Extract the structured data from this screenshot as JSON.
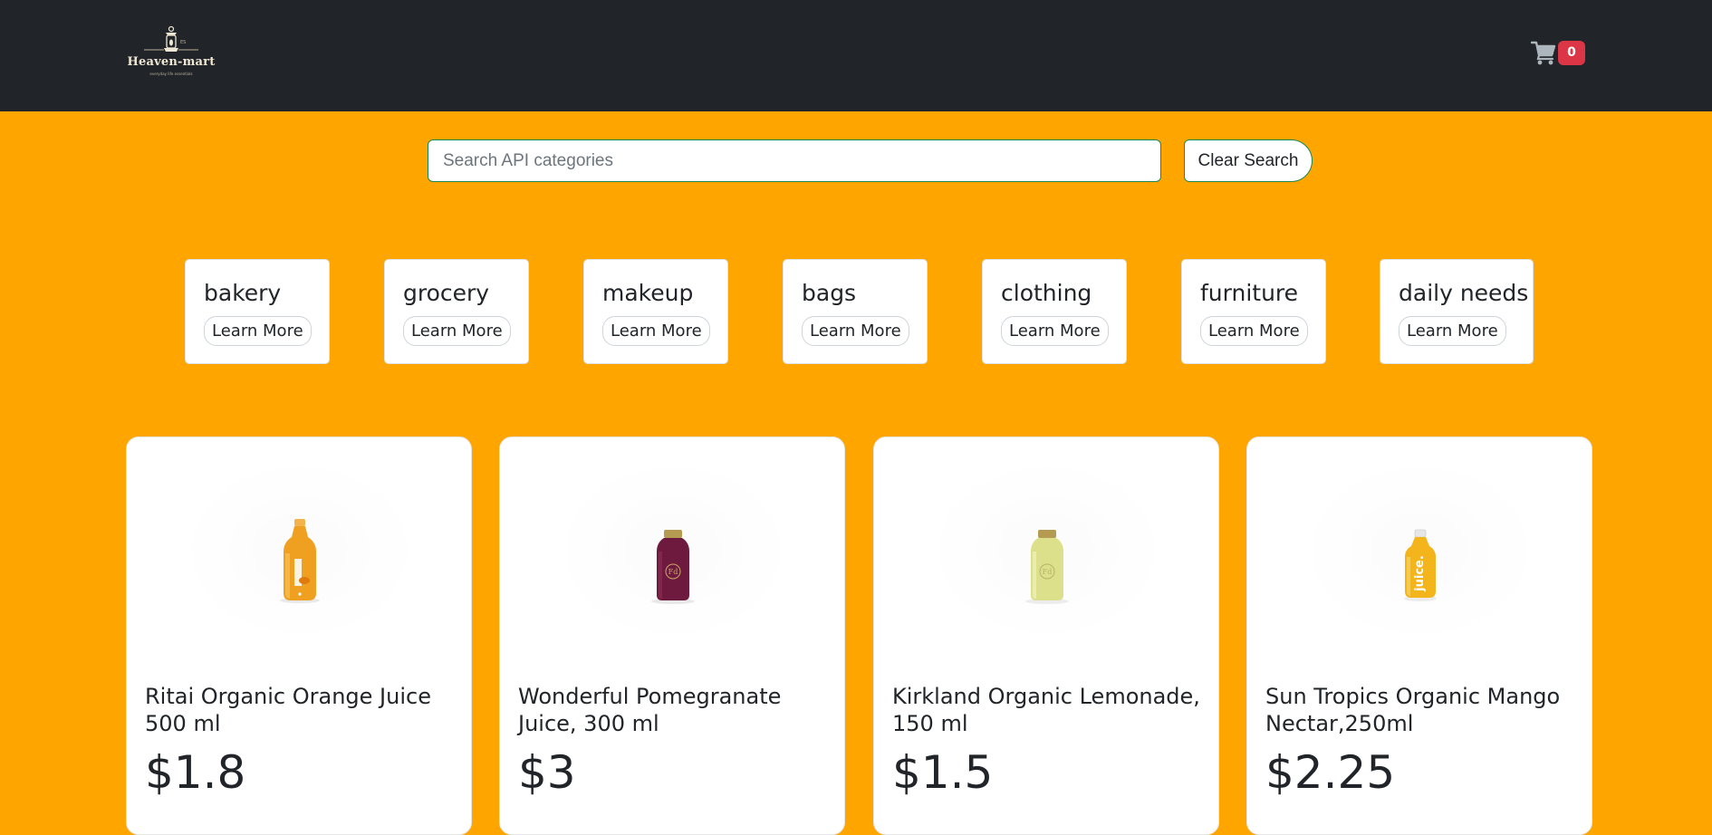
{
  "header": {
    "logo_text": "Heaven-mart",
    "logo_tagline": "everyday life essentials",
    "cart_count": "0",
    "colors": {
      "bar": "#212529",
      "badge": "#dc3545"
    }
  },
  "search": {
    "placeholder": "Search API categories",
    "value": "",
    "clear_label": "Clear Search"
  },
  "categories": [
    {
      "name": "bakery",
      "button": "Learn More"
    },
    {
      "name": "grocery",
      "button": "Learn More"
    },
    {
      "name": "makeup",
      "button": "Learn More"
    },
    {
      "name": "bags",
      "button": "Learn More"
    },
    {
      "name": "clothing",
      "button": "Learn More"
    },
    {
      "name": "furniture",
      "button": "Learn More"
    },
    {
      "name": "daily needs",
      "button": "Learn More"
    }
  ],
  "products": [
    {
      "title": "Ritai Organic Orange Juice 500 ml",
      "price": "$1.8",
      "image": "orange-juice-bottle",
      "color": "#f0a020"
    },
    {
      "title": "Wonderful Pomegranate Juice, 300 ml",
      "price": "$3",
      "image": "pomegranate-juice-bottle",
      "color": "#6e1a3e"
    },
    {
      "title": "Kirkland Organic Lemonade, 150 ml",
      "price": "$1.5",
      "image": "lemonade-bottle",
      "color": "#dde08a"
    },
    {
      "title": "Sun Tropics Organic Mango Nectar,250ml",
      "price": "$2.25",
      "image": "mango-nectar-bottle",
      "color": "#f3b41c"
    }
  ],
  "theme": {
    "background": "#ffa500"
  }
}
